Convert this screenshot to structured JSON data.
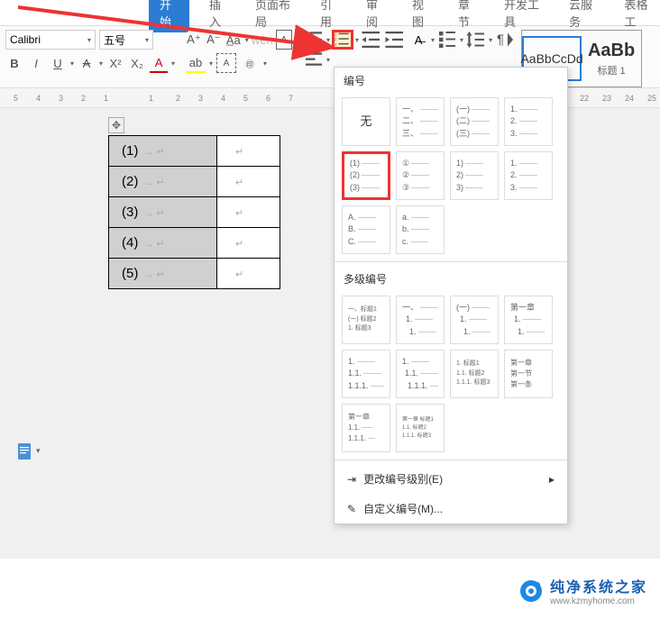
{
  "tabs": {
    "items": [
      "开始",
      "插入",
      "页面布局",
      "引用",
      "审阅",
      "视图",
      "章节",
      "开发工具",
      "云服务",
      "表格工"
    ],
    "active_index": 0
  },
  "toolbar": {
    "font_name": "Calibri",
    "font_size": "五号",
    "bold": "B",
    "italic": "I",
    "underline": "U",
    "strike": "S",
    "sup": "A",
    "sub": "X²",
    "x2": "X₂",
    "a_case": "A",
    "wen": "wén",
    "a_plus": "A⁺",
    "a_minus": "A⁻"
  },
  "styles": {
    "item1_preview": "AaBbCcDd",
    "item1_label": "",
    "item2_preview": "AaBb",
    "item2_label": "标题 1"
  },
  "ruler": {
    "marks": [
      "5",
      "4",
      "3",
      "2",
      "1",
      "",
      "1",
      "2",
      "3",
      "4",
      "5",
      "6",
      "7",
      "22",
      "23",
      "24",
      "25"
    ]
  },
  "table_rows": [
    "(1)",
    "(2)",
    "(3)",
    "(4)",
    "(5)"
  ],
  "popup": {
    "title_numbering": "编号",
    "title_multilevel": "多级编号",
    "none_label": "无",
    "options_row1": [
      [
        "一、",
        "二、",
        "三、"
      ],
      [
        "(一)",
        "(二)",
        "(三)"
      ],
      [
        "1.",
        "2.",
        "3."
      ]
    ],
    "options_row2": [
      [
        "(1)",
        "(2)",
        "(3)"
      ],
      [
        "①",
        "②",
        "③"
      ],
      [
        "1)",
        "2)",
        "3)"
      ],
      [
        "1.",
        "2.",
        "3."
      ]
    ],
    "options_row3": [
      [
        "A.",
        "B.",
        "C."
      ],
      [
        "a.",
        "b.",
        "c."
      ]
    ],
    "multilevel_row1": [
      [
        "一、标题1",
        "(一) 标题2",
        "1. 标题3"
      ],
      [
        "一、",
        "1.",
        "1."
      ],
      [
        "(一)",
        "1.",
        "1."
      ],
      [
        "第一章",
        "1.",
        "1."
      ]
    ],
    "multilevel_row2": [
      [
        "1.",
        "1.1.",
        "1.1.1."
      ],
      [
        "1.",
        "1.1.",
        "1.1.1."
      ],
      [
        "1. 标题1",
        "1.1. 标题2",
        "1.1.1. 标题3"
      ],
      [
        "第一章",
        "第一节",
        "第一条"
      ]
    ],
    "multilevel_row3": [
      [
        "第一章",
        "1.1.",
        "1.1.1."
      ],
      [
        "第一章 标题1",
        "1.1. 标题2",
        "1.1.1. 标题3"
      ]
    ],
    "action_change_level": "更改编号级别(E)",
    "action_custom": "自定义编号(M)..."
  },
  "watermark": {
    "title": "纯净系统之家",
    "url": "www.kzmyhome.com"
  }
}
